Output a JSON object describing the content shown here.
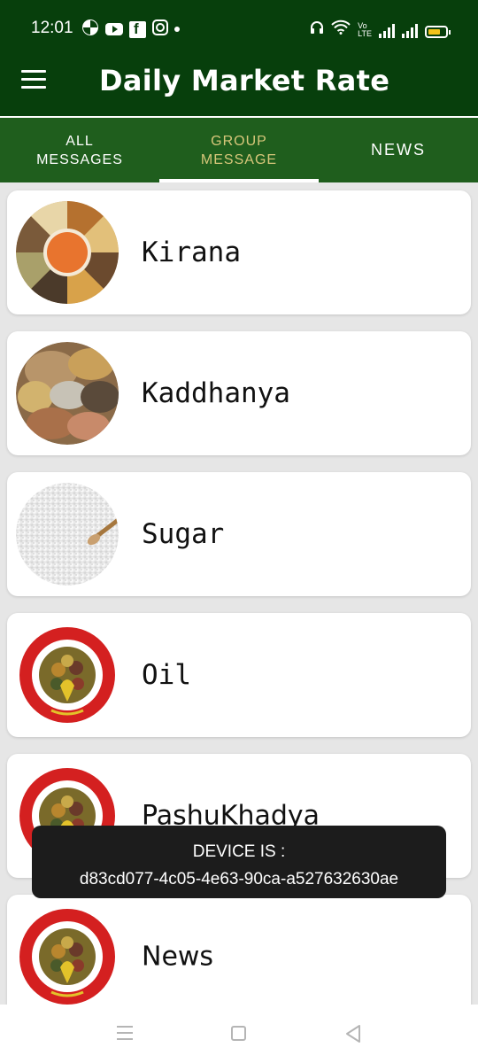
{
  "status_bar": {
    "time": "12:01",
    "lte_label": "Vo\nLTE",
    "icons": [
      "pinwheel-icon",
      "youtube-icon",
      "facebook-icon",
      "instagram-icon",
      "dot-icon",
      "headset-icon",
      "wifi-icon",
      "volte-icon",
      "signal-icon",
      "signal-icon",
      "battery-icon"
    ]
  },
  "app_bar": {
    "title": "Daily Market Rate",
    "menu_icon": "hamburger-menu-icon"
  },
  "tabs": [
    {
      "label": "ALL\nMESSAGES",
      "active": false
    },
    {
      "label": "GROUP\nMESSAGE",
      "active": true
    },
    {
      "label": "NEWS",
      "active": false
    }
  ],
  "groups": [
    {
      "label": "Kirana",
      "thumb": "grains-platter"
    },
    {
      "label": "Kaddhanya",
      "thumb": "spice-heaps"
    },
    {
      "label": "Sugar",
      "thumb": "sugar"
    },
    {
      "label": "Oil",
      "thumb": "seal-logo"
    },
    {
      "label": "PashuKhadya",
      "thumb": "seal-logo"
    },
    {
      "label": "News",
      "thumb": "seal-logo"
    }
  ],
  "seal_text": "डेली मार्केट रेट्स एस.एम.एस. सर्विस",
  "toast": {
    "line1": "DEVICE IS :",
    "line2": "d83cd077-4c05-4e63-90ca-a527632630ae"
  },
  "colors": {
    "app_bar": "#073f0c",
    "tab_bar": "#1f5e1d",
    "active_tab_text": "#d7c77a",
    "seal_red": "#d42020"
  }
}
